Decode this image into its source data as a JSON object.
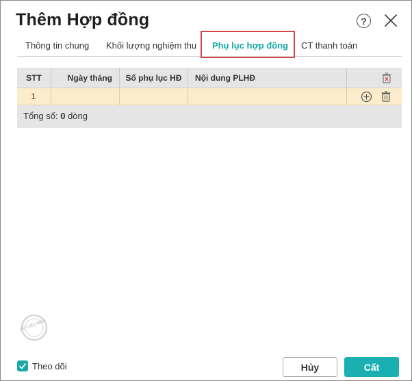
{
  "dialog": {
    "title": "Thêm Hợp đồng",
    "help_icon": "question-circle-icon",
    "close_icon": "close-icon"
  },
  "tabs": [
    {
      "label": "Thông tin chung",
      "active": false
    },
    {
      "label": "Khối lượng nghiệm thu",
      "active": false
    },
    {
      "label": "Phụ lục hợp đồng",
      "active": true
    },
    {
      "label": "CT thanh toán",
      "active": false
    }
  ],
  "grid": {
    "columns": [
      "STT",
      "Ngày tháng",
      "Số phụ lục HĐ",
      "Nội dung PLHĐ"
    ],
    "header_icon": "delete-all-icon",
    "rows": [
      {
        "stt": "1",
        "date": "",
        "appendix_no": "",
        "content": "",
        "row_icons": [
          "add-circle-icon",
          "trash-icon"
        ]
      }
    ],
    "footer": {
      "prefix": "Tổng số:",
      "count": "0",
      "suffix": "dòng"
    }
  },
  "watermark": {
    "text": "DỮ LIỆU MẪU"
  },
  "footer": {
    "follow_label": "Theo dõi",
    "follow_checked": true,
    "cancel_label": "Hủy",
    "save_label": "Cất"
  },
  "colors": {
    "accent": "#1ab0b1",
    "active_row": "#fbeccb",
    "tab_highlight_border": "#d64545"
  }
}
